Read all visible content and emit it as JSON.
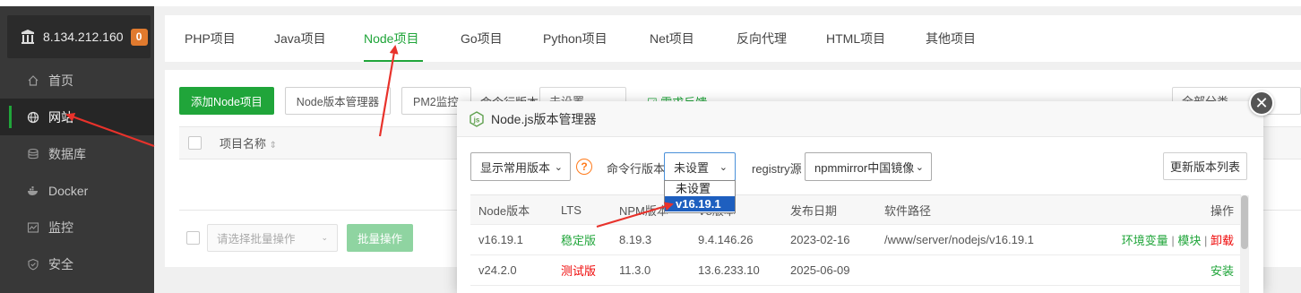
{
  "server": {
    "ip": "8.134.212.160",
    "alerts": "0"
  },
  "sidebar": {
    "items": [
      {
        "label": "首页",
        "icon": "home-icon"
      },
      {
        "label": "网站",
        "icon": "globe-icon"
      },
      {
        "label": "数据库",
        "icon": "database-icon"
      },
      {
        "label": "Docker",
        "icon": "docker-icon"
      },
      {
        "label": "监控",
        "icon": "monitor-icon"
      },
      {
        "label": "安全",
        "icon": "shield-icon"
      }
    ]
  },
  "tabs": [
    "PHP项目",
    "Java项目",
    "Node项目",
    "Go项目",
    "Python项目",
    "Net项目",
    "反向代理",
    "HTML项目",
    "其他项目"
  ],
  "toolbar": {
    "add_node": "添加Node项目",
    "node_manager": "Node版本管理器",
    "pm2": "PM2监控",
    "cli_version_label": "命令行版本",
    "cli_version_value": "未设置",
    "feedback": "需求反馈",
    "category": "全部分类"
  },
  "table": {
    "col_name": "项目名称"
  },
  "footer": {
    "batch_placeholder": "请选择批量操作",
    "batch_button": "批量操作"
  },
  "modal": {
    "title": "Node.js版本管理器",
    "filter": "显示常用版本",
    "cli_label": "命令行版本",
    "cli_value": "未设置",
    "registry_label": "registry源",
    "registry_value": "npmmirror中国镜像",
    "refresh": "更新版本列表",
    "dropdown_options": [
      "未设置",
      "v16.19.1"
    ],
    "headers": [
      "Node版本",
      "LTS",
      "NPM版本",
      "V8版本",
      "发布日期",
      "软件路径",
      "操作"
    ],
    "rows": [
      {
        "version": "v16.19.1",
        "lts": "稳定版",
        "npm": "8.19.3",
        "v8": "9.4.146.26",
        "date": "2023-02-16",
        "path": "/www/server/nodejs/v16.19.1",
        "actions": [
          "环境变量",
          "模块",
          "卸载"
        ]
      },
      {
        "version": "v24.2.0",
        "lts": "测试版",
        "npm": "11.3.0",
        "v8": "13.6.233.10",
        "date": "2025-06-09",
        "path": "",
        "actions": [
          "安装"
        ]
      }
    ]
  },
  "colors": {
    "accent": "#20a53a",
    "danger": "#ef0808",
    "annotation": "#e8322b"
  }
}
